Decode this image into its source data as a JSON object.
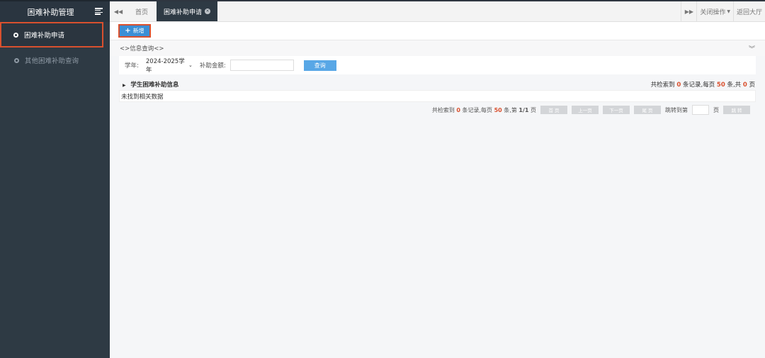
{
  "sidebar": {
    "title": "困难补助管理",
    "items": [
      {
        "label": "困难补助申请",
        "active": true
      },
      {
        "label": "其他困难补助查询",
        "active": false
      }
    ]
  },
  "tabs": {
    "items": [
      {
        "label": "首页",
        "active": false
      },
      {
        "label": "困难补助申请",
        "active": true
      }
    ],
    "close_ops": "关闭操作",
    "back_hall": "返回大厅"
  },
  "toolbar": {
    "add_label": "新增"
  },
  "query_section": {
    "title": "<>信息查询<>"
  },
  "filter": {
    "year_label": "学年:",
    "year_value": "2024-2025学年",
    "amount_label": "补助金额:",
    "amount_value": "",
    "query_button": "查询"
  },
  "grid": {
    "title": "学生困难补助信息",
    "summary_prefix": "共检索到",
    "records": "0",
    "summary_mid1": "条记录,每页",
    "per_page": "50",
    "summary_mid2": "条,共",
    "pages_total": "0",
    "summary_suffix": "页",
    "empty_text": "未找到相关数据"
  },
  "pager": {
    "prefix": "共检索到",
    "records": "0",
    "mid1": "条记录,每页",
    "per_page": "50",
    "mid2": "条,第",
    "current": "1/1",
    "suffix": "页",
    "first": "首 页",
    "prev": "上一页",
    "next": "下一页",
    "last": "尾 页",
    "jump_label": "跳转到第",
    "jump_suffix": "页",
    "jump_button": "跳 转"
  },
  "colors": {
    "accent": "#3b8fd6",
    "highlight_border": "#d9502e",
    "sidebar_bg": "#2e3a44"
  }
}
